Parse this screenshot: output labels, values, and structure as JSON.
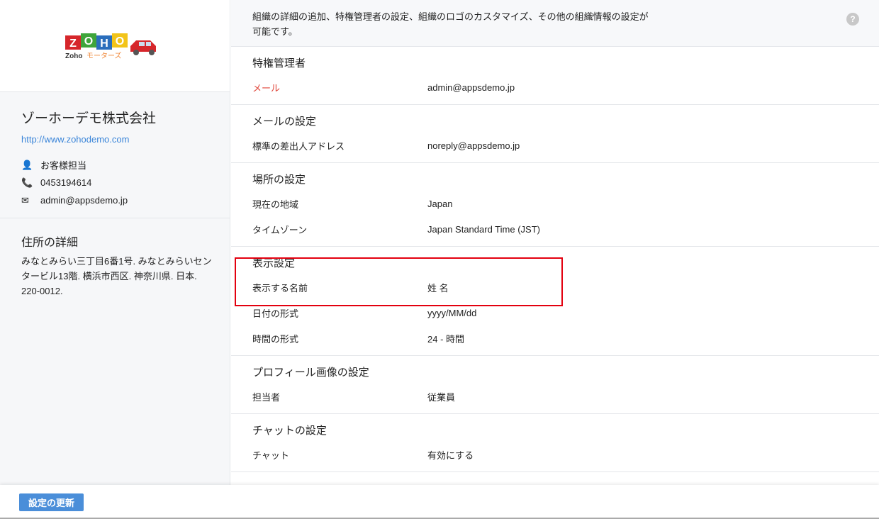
{
  "logo": {
    "text": "ZOHO",
    "sub": "Zoho モーターズ"
  },
  "org": {
    "name": "ゾーホーデモ株式会社",
    "url": "http://www.zohodemo.com",
    "contact": "お客様担当",
    "phone": "0453194614",
    "email": "admin@appsdemo.jp"
  },
  "address": {
    "title": "住所の詳細",
    "text": "みなとみらい三丁目6番1号. みなとみらいセンタービル13階. 横浜市西区. 神奈川県. 日本. 220-0012."
  },
  "header": {
    "description": "組織の詳細の追加、特権管理者の設定、組織のロゴのカスタマイズ、その他の組織情報の設定が可能です。",
    "help": "?"
  },
  "sections": [
    {
      "title": "特権管理者",
      "rows": [
        {
          "label": "メール",
          "value": "admin@appsdemo.jp"
        }
      ]
    },
    {
      "title": "メールの設定",
      "rows": [
        {
          "label": "標準の差出人アドレス",
          "value": "noreply@appsdemo.jp"
        }
      ]
    },
    {
      "title": "場所の設定",
      "rows": [
        {
          "label": "現在の地域",
          "value": "Japan"
        },
        {
          "label": "タイムゾーン",
          "value": "Japan Standard Time (JST)"
        }
      ]
    },
    {
      "title": "表示設定",
      "rows": [
        {
          "label": "表示する名前",
          "value": "姓 名"
        },
        {
          "label": "日付の形式",
          "value": "yyyy/MM/dd"
        },
        {
          "label": "時間の形式",
          "value": "24 - 時間"
        }
      ]
    },
    {
      "title": "プロフィール画像の設定",
      "rows": [
        {
          "label": "担当者",
          "value": "従業員"
        }
      ]
    },
    {
      "title": "チャットの設定",
      "rows": [
        {
          "label": "チャット",
          "value": "有効にする"
        }
      ]
    }
  ],
  "footer": {
    "update_button": "設定の更新"
  }
}
